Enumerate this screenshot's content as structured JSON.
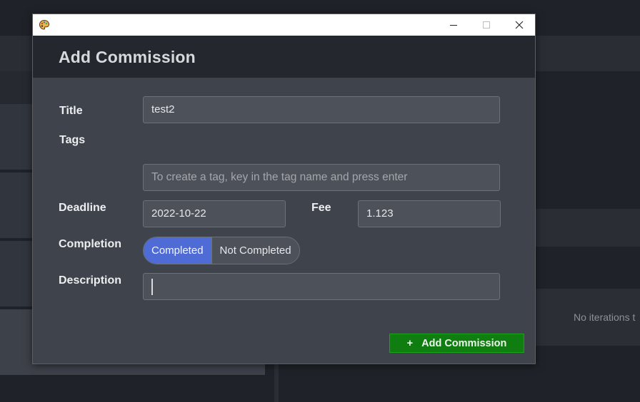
{
  "background": {
    "no_iterations_text": "No iterations t"
  },
  "window": {
    "app_icon": "palette-icon",
    "controls": [
      "minimize-icon",
      "maximize-icon",
      "close-icon"
    ]
  },
  "dialog": {
    "title": "Add Commission",
    "fields": {
      "title_label": "Title",
      "title_value": "test2",
      "tags_label": "Tags",
      "tags_placeholder": "To create a tag, key in the tag name and press enter",
      "deadline_label": "Deadline",
      "deadline_value": "2022-10-22",
      "fee_label": "Fee",
      "fee_value": "1.123",
      "completion_label": "Completion",
      "completion_options": [
        "Completed",
        "Not Completed"
      ],
      "completion_selected": "Completed",
      "description_label": "Description",
      "description_value": ""
    },
    "submit_icon": "+",
    "submit_label": "Add Commission"
  },
  "colors": {
    "accent": "#4f6bd6",
    "submit": "#0f7d0f",
    "header_bg": "#24272d",
    "dialog_bg": "#3f434b"
  }
}
